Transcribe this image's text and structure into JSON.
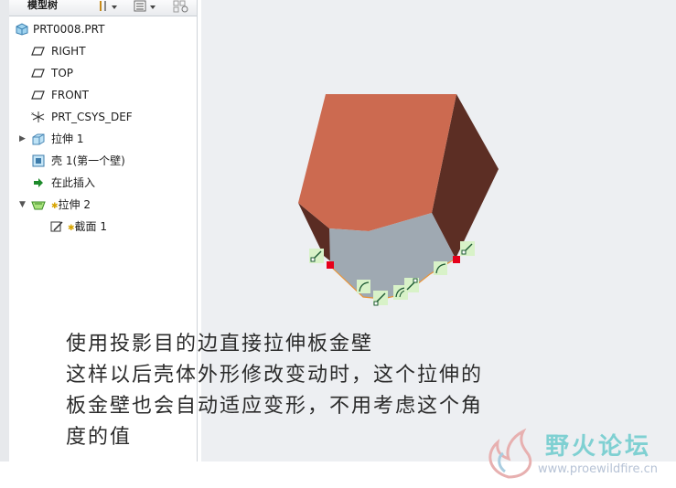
{
  "model_tree": {
    "title": "模型树",
    "items": [
      {
        "label": "PRT0008.PRT",
        "icon": "part-icon",
        "expander": ""
      },
      {
        "label": "RIGHT",
        "icon": "datum-plane-icon",
        "expander": ""
      },
      {
        "label": "TOP",
        "icon": "datum-plane-icon",
        "expander": ""
      },
      {
        "label": "FRONT",
        "icon": "datum-plane-icon",
        "expander": ""
      },
      {
        "label": "PRT_CSYS_DEF",
        "icon": "coordinate-system-icon",
        "expander": ""
      },
      {
        "label": "拉伸 1",
        "icon": "extrude-icon",
        "expander": "▶"
      },
      {
        "label": "壳 1(第一个壁)",
        "icon": "shell-icon",
        "expander": ""
      },
      {
        "label": "在此插入",
        "icon": "insert-here-arrow-icon",
        "expander": ""
      },
      {
        "label": "拉伸 2",
        "icon": "sheetmetal-extrude-icon",
        "expander": "▼"
      },
      {
        "label": "截面 1",
        "icon": "sketch-section-icon",
        "expander": ""
      }
    ]
  },
  "caption": {
    "lines": [
      "使用投影目的边直接拉伸板金壁",
      "这样以后壳体外形修改变动时，这个拉伸的",
      "板金壁也会自动适应变形，不用考虑这个角",
      "度的值"
    ]
  },
  "watermark": {
    "site_name": "野火论坛",
    "url": "www.proewildfire.cn"
  },
  "colors": {
    "top_face": "#cc6a50",
    "side_face": "#5e2f25",
    "inner_face": "#9fa9b2",
    "viewport_bg": "#edeff2",
    "sketch_marker": "#e6001a",
    "constraint_marker": "#d8f2c8"
  }
}
